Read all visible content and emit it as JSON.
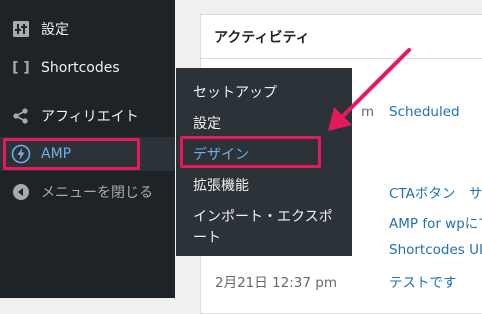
{
  "sidebar": {
    "items": [
      {
        "label": "設定",
        "icon": "settings-sliders-icon"
      },
      {
        "label": "Shortcodes",
        "icon": "brackets-icon"
      },
      {
        "label": "アフィリエイト",
        "icon": "share-icon"
      },
      {
        "label": "AMP",
        "icon": "amp-lightning-icon"
      },
      {
        "label": "メニューを閉じる",
        "icon": "collapse-arrow-icon"
      }
    ]
  },
  "flyout": {
    "items": [
      "セットアップ",
      "設定",
      "デザイン",
      "拡張機能",
      "インポート・エクスポ",
      "ート"
    ]
  },
  "activity": {
    "title": "アクティビティ",
    "partial_time": "m",
    "scheduled": "Scheduled",
    "posts": [
      "CTAボタン　サ",
      "AMP for wpにて",
      "Shortcodes UI"
    ],
    "last_date": "2月21日 12:37 pm",
    "last_title": "テストです"
  },
  "colors": {
    "sidebar_bg": "#1d2327",
    "flyout_bg": "#2c3338",
    "active_blue": "#72aee6",
    "highlight_pink": "#e7195a",
    "link_blue": "#2271b1"
  }
}
